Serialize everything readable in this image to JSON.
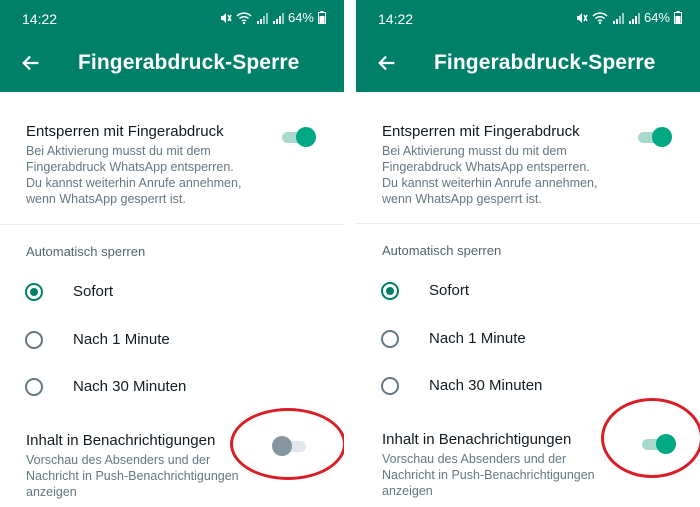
{
  "statusbar": {
    "time": "14:22",
    "battery": "64%",
    "icons": [
      "mute-icon",
      "wifi-icon",
      "signal-icon",
      "signal-icon",
      "battery-icon"
    ]
  },
  "appbar": {
    "title": "Fingerabdruck-Sperre",
    "back_icon": "arrow-left-icon"
  },
  "fingerprint": {
    "title": "Entsperren mit Fingerabdruck",
    "description_lines": [
      "Bei Aktivierung musst du mit dem",
      "Fingerabdruck WhatsApp entsperren.",
      "Du kannst weiterhin Anrufe annehmen,",
      "wenn WhatsApp gesperrt ist."
    ],
    "enabled": true
  },
  "autolock": {
    "heading": "Automatisch sperren",
    "options": [
      "Sofort",
      "Nach 1 Minute",
      "Nach 30 Minuten"
    ],
    "selected": "Sofort"
  },
  "notifications": {
    "title": "Inhalt in Benachrichtigungen",
    "description_lines": [
      "Vorschau des Absenders und der",
      "Nachricht in Push-Benachrichtigungen",
      "anzeigen"
    ]
  },
  "panels": [
    {
      "notifications_enabled": false
    },
    {
      "notifications_enabled": true
    }
  ],
  "colors": {
    "header": "#008069",
    "accent": "#00a884",
    "highlight_circle": "#d81e26"
  }
}
